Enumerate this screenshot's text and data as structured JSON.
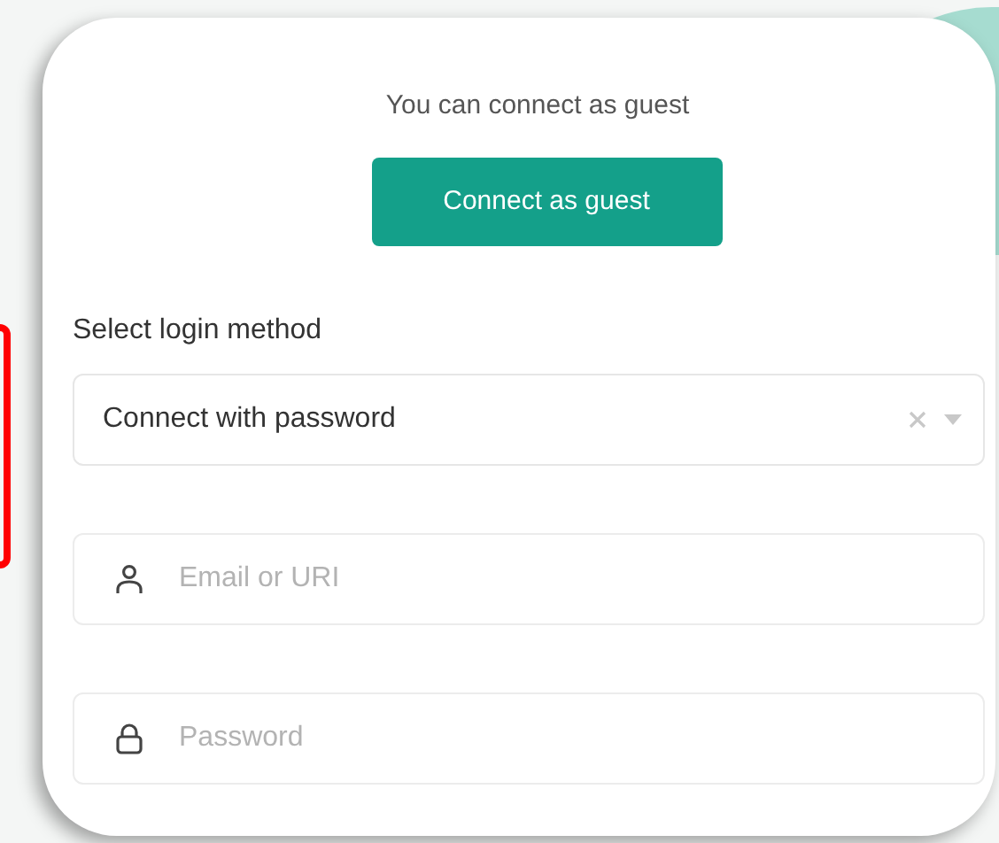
{
  "guest_message": "You can connect as guest",
  "guest_button": {
    "label": "Connect as guest"
  },
  "login_method": {
    "label": "Select login method",
    "value": "Connect with password"
  },
  "fields": [
    {
      "kind": "user",
      "placeholder": "Email or URI"
    },
    {
      "kind": "lock",
      "placeholder": "Password"
    }
  ]
}
